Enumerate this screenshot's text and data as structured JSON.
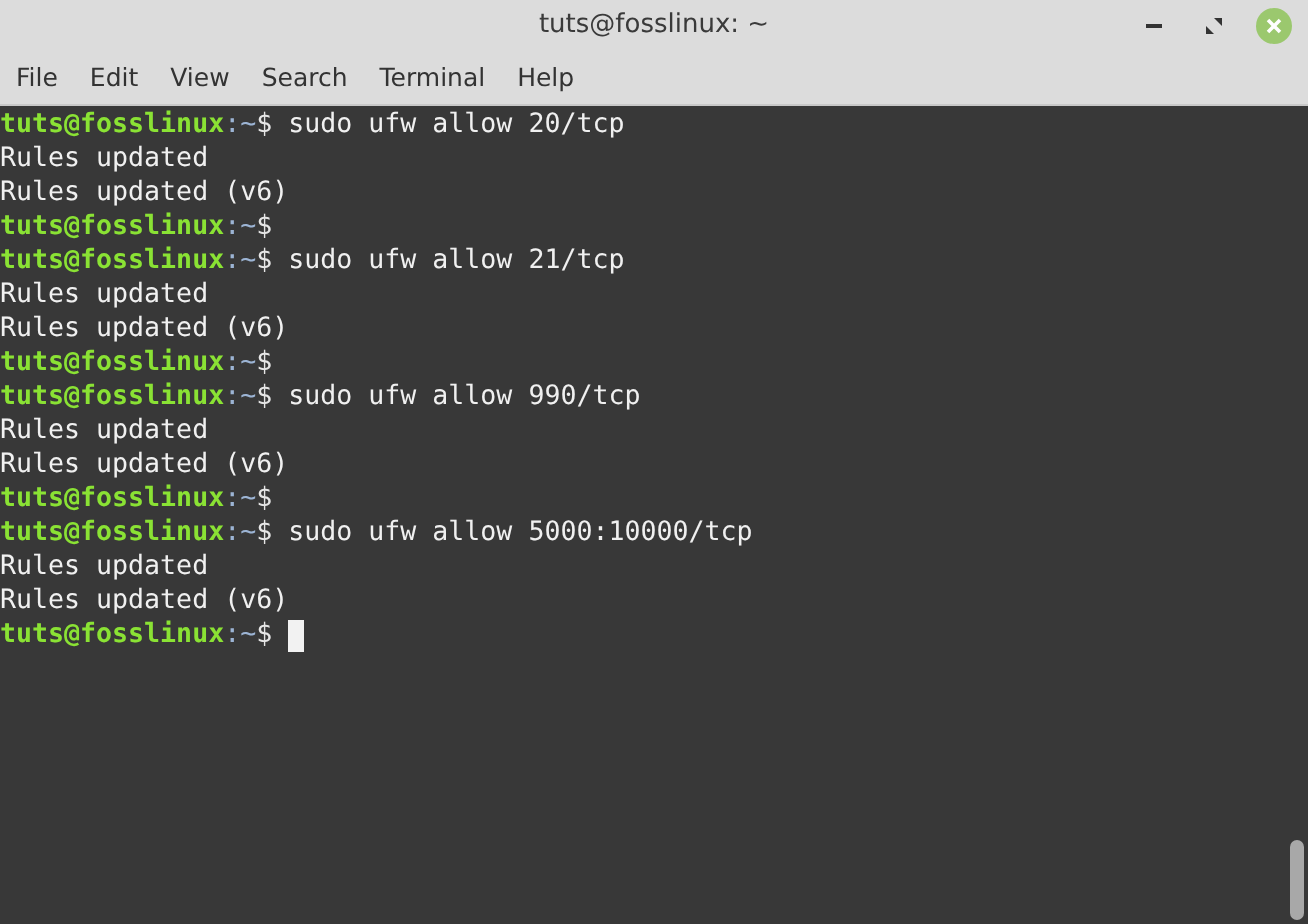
{
  "window": {
    "title": "tuts@fosslinux: ~"
  },
  "menu": [
    "File",
    "Edit",
    "View",
    "Search",
    "Terminal",
    "Help"
  ],
  "lines": [
    {
      "kind": "prompt",
      "user": "tuts@fosslinux",
      "path": ":~",
      "sign": "$",
      "command": "sudo ufw allow 20/tcp",
      "cursor": false
    },
    {
      "kind": "output",
      "text": "Rules updated"
    },
    {
      "kind": "output",
      "text": "Rules updated (v6)"
    },
    {
      "kind": "prompt",
      "user": "tuts@fosslinux",
      "path": ":~",
      "sign": "$",
      "cursor": false
    },
    {
      "kind": "prompt",
      "user": "tuts@fosslinux",
      "path": ":~",
      "sign": "$",
      "command": "sudo ufw allow 21/tcp",
      "cursor": false
    },
    {
      "kind": "output",
      "text": "Rules updated"
    },
    {
      "kind": "output",
      "text": "Rules updated (v6)"
    },
    {
      "kind": "prompt",
      "user": "tuts@fosslinux",
      "path": ":~",
      "sign": "$",
      "cursor": false
    },
    {
      "kind": "prompt",
      "user": "tuts@fosslinux",
      "path": ":~",
      "sign": "$",
      "command": "sudo ufw allow 990/tcp",
      "cursor": false
    },
    {
      "kind": "output",
      "text": "Rules updated"
    },
    {
      "kind": "output",
      "text": "Rules updated (v6)"
    },
    {
      "kind": "prompt",
      "user": "tuts@fosslinux",
      "path": ":~",
      "sign": "$",
      "cursor": false
    },
    {
      "kind": "prompt",
      "user": "tuts@fosslinux",
      "path": ":~",
      "sign": "$",
      "command": "sudo ufw allow 5000:10000/tcp",
      "cursor": false
    },
    {
      "kind": "output",
      "text": "Rules updated"
    },
    {
      "kind": "output",
      "text": "Rules updated (v6)"
    },
    {
      "kind": "prompt",
      "user": "tuts@fosslinux",
      "path": ":~",
      "sign": "$",
      "cursor": true
    }
  ]
}
